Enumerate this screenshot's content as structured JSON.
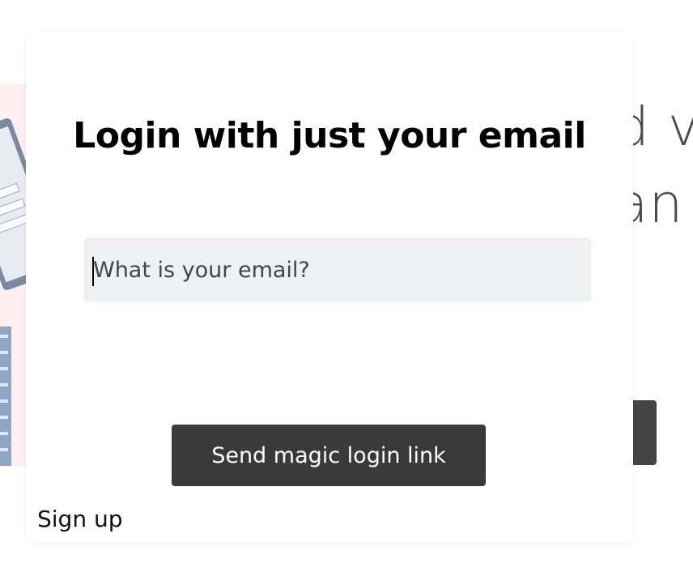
{
  "background": {
    "text_line_1": "d v",
    "text_line_2": "an"
  },
  "modal": {
    "title": "Login with just your email",
    "email_placeholder": "What is your email?",
    "email_value": "",
    "send_button_label": "Send magic login link",
    "signup_label": "Sign up"
  },
  "colors": {
    "button": "#3a3a3a",
    "input_bg": "#eef0f4",
    "hero_bg": "#fdeff0"
  }
}
